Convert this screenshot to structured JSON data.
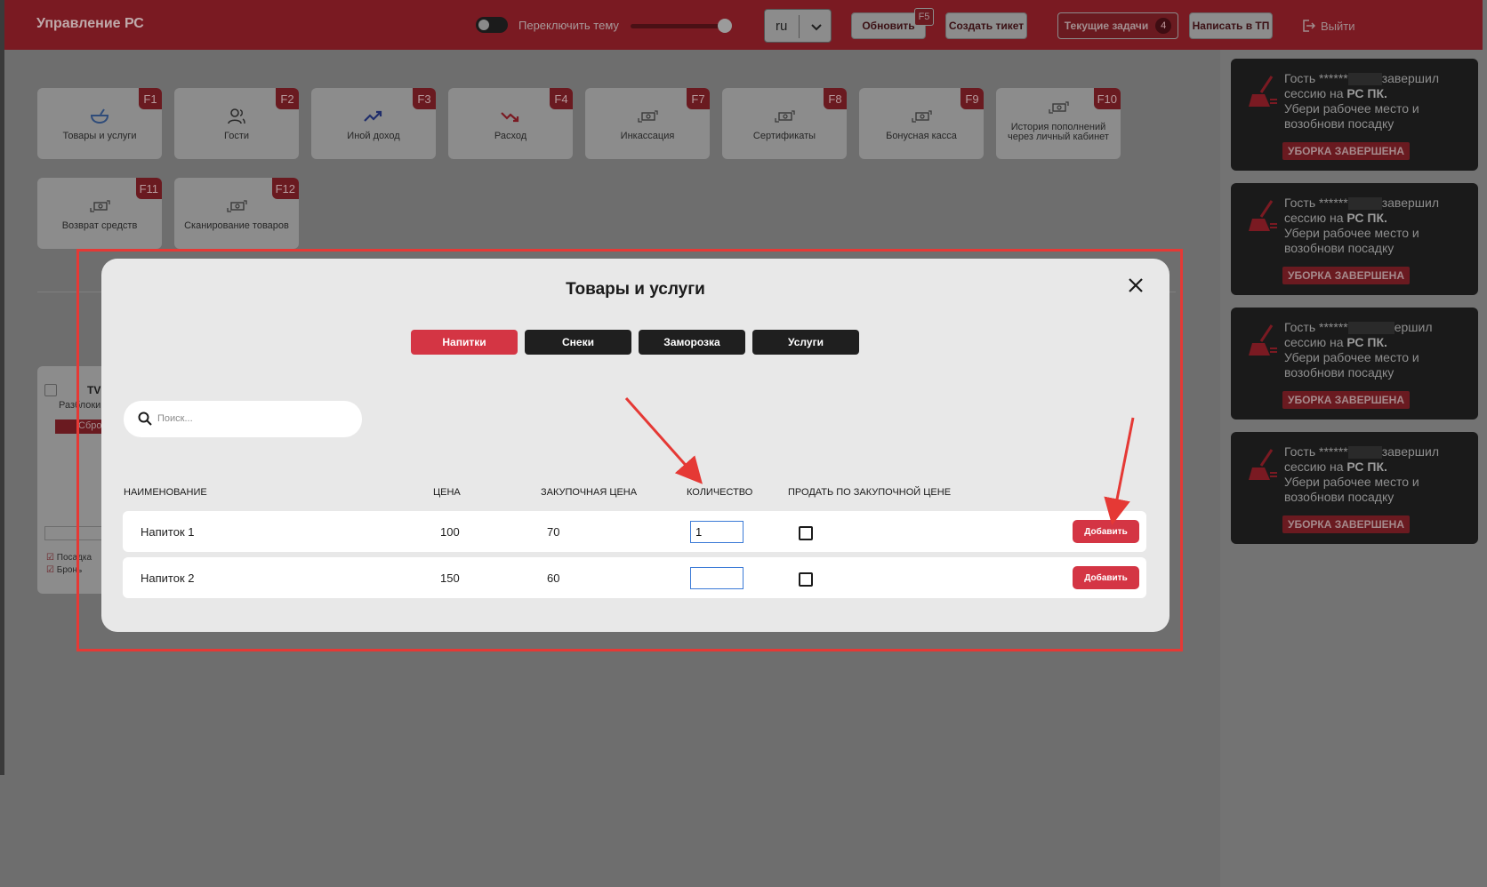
{
  "header": {
    "title": "Управление РС",
    "theme_label": "Переключить тему",
    "language": "ru",
    "buttons": {
      "refresh": "Обновить",
      "refresh_key": "F5",
      "create_ticket": "Создать тикет",
      "current_tasks": "Текущие задачи",
      "current_tasks_count": "4",
      "write_support": "Написать в ТП",
      "logout": "Выйти"
    }
  },
  "tiles": [
    {
      "key": "F1",
      "label": "Товары и услуги",
      "icon": "bowl-icon"
    },
    {
      "key": "F2",
      "label": "Гости",
      "icon": "guests-icon"
    },
    {
      "key": "F3",
      "label": "Иной доход",
      "icon": "trend-up-icon"
    },
    {
      "key": "F4",
      "label": "Расход",
      "icon": "trend-down-icon"
    },
    {
      "key": "F7",
      "label": "Инкассация",
      "icon": "cash-exchange-icon"
    },
    {
      "key": "F8",
      "label": "Сертификаты",
      "icon": "cash-exchange-icon"
    },
    {
      "key": "F9",
      "label": "Бонусная касса",
      "icon": "cash-exchange-icon"
    },
    {
      "key": "F10",
      "label": "История пополнений через личный кабинет",
      "icon": "cash-exchange-icon"
    },
    {
      "key": "F11",
      "label": "Возврат средств",
      "icon": "cash-exchange-icon"
    },
    {
      "key": "F12",
      "label": "Сканирование товаров",
      "icon": "cash-exchange-icon"
    }
  ],
  "background": {
    "panel_title": "TV",
    "panel_sub": "Разблоки",
    "panel_btn": "Сбро",
    "check1": "Посадка",
    "check2": "Бронь"
  },
  "notifications": [
    {
      "prefix": "Гость ******",
      "suffix": "завершил",
      "line2_a": "сессию на ",
      "line2_b": "РС ПК.",
      "line3": "Убери рабочее место и",
      "line4": "возобнови посадку",
      "badge": "УБОРКА ЗАВЕРШЕНА"
    },
    {
      "prefix": "Гость ******",
      "suffix": "завершил",
      "line2_a": "сессию на ",
      "line2_b": "РС ПК.",
      "line3": "Убери рабочее место и",
      "line4": "возобнови посадку",
      "badge": "УБОРКА ЗАВЕРШЕНА"
    },
    {
      "prefix": "Гость ******",
      "suffix": "ершил",
      "line2_a": "сессию на ",
      "line2_b": "РС ПК.",
      "line3": "Убери рабочее место и",
      "line4": "возобнови посадку",
      "badge": "УБОРКА ЗАВЕРШЕНА"
    },
    {
      "prefix": "Гость ******",
      "suffix": "завершил",
      "line2_a": "сессию на ",
      "line2_b": "РС ПК.",
      "line3": "Убери рабочее место и",
      "line4": "возобнови посадку",
      "badge": "УБОРКА ЗАВЕРШЕНА"
    }
  ],
  "modal": {
    "title": "Товары и услуги",
    "tabs": [
      "Напитки",
      "Снеки",
      "Заморозка",
      "Услуги"
    ],
    "active_tab": "Напитки",
    "search_placeholder": "Поиск...",
    "columns": {
      "name": "НАИМЕНОВАНИЕ",
      "price": "ЦЕНА",
      "purchase_price": "ЗАКУПОЧНАЯ ЦЕНА",
      "quantity": "КОЛИЧЕСТВО",
      "sell_at_purchase": "ПРОДАТЬ ПО ЗАКУПОЧНОЙ ЦЕНЕ"
    },
    "rows": [
      {
        "name": "Напиток 1",
        "price": "100",
        "purchase_price": "70",
        "quantity": "1",
        "sell_at_purchase": false,
        "action": "Добавить"
      },
      {
        "name": "Напиток 2",
        "price": "150",
        "purchase_price": "60",
        "quantity": "",
        "sell_at_purchase": false,
        "action": "Добавить"
      }
    ]
  },
  "colors": {
    "accent": "#d43544",
    "header_bg": "#7a1a22",
    "annotation": "#e53935",
    "notification_bg": "#1a1a1a"
  }
}
